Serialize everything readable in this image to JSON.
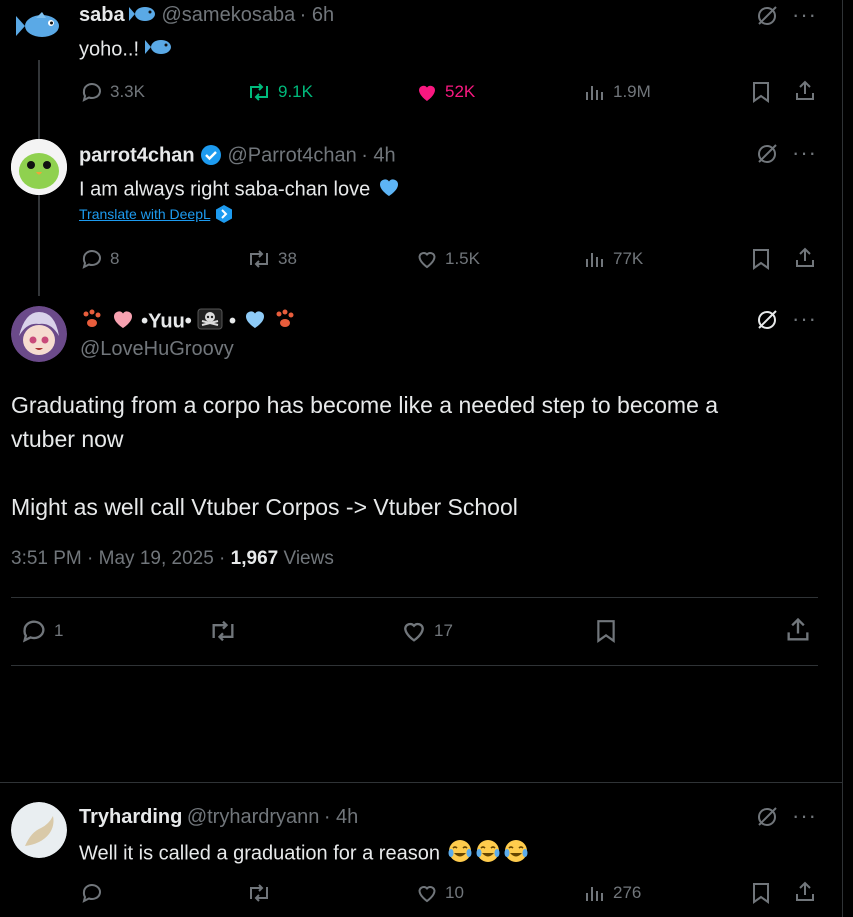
{
  "tweets": [
    {
      "name": "saba",
      "handle": "@samekosaba",
      "time": "· 6h",
      "text": "yoho..!",
      "replies": "3.3K",
      "retweets": "9.1K",
      "likes": "52K",
      "views": "1.9M"
    },
    {
      "name": "parrot4chan",
      "handle": "@Parrot4chan",
      "time": "· 4h",
      "text": "I am always right saba-chan love",
      "translate": "Translate with DeepL",
      "replies": "8",
      "retweets": "38",
      "likes": "1.5K",
      "views": "77K"
    }
  ],
  "main": {
    "name_prefix": "•Yuu•",
    "name_suffix": "•",
    "handle": "@LoveHuGroovy",
    "text_line1": "Graduating from a corpo has become like a needed step to become a",
    "text_line2": "vtuber now",
    "text_line3": "Might as well call Vtuber Corpos -> Vtuber School",
    "timestamp": "3:51 PM · May 19, 2025 · ",
    "views_count": "1,967",
    "views_label": " Views",
    "replies": "1",
    "likes": "17"
  },
  "reply": {
    "name": "Tryharding",
    "handle": "@tryhardryann",
    "time": "· 4h",
    "text": "Well it is called a graduation for a reason",
    "likes": "10",
    "views": "276"
  },
  "colors": {
    "retweet_active": "#00ba7c",
    "like_active": "#f91880",
    "verified": "#1d9bf0",
    "link": "#1d9bf0"
  }
}
